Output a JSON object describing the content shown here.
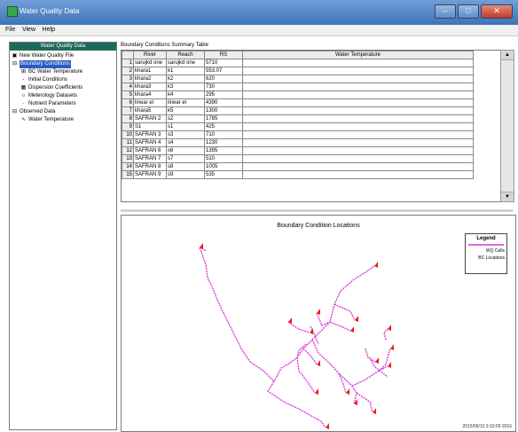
{
  "window": {
    "title": "Water Quality Data",
    "btn_min": "–",
    "btn_max": "□",
    "btn_close": "✕"
  },
  "menu": [
    "File",
    "View",
    "Help"
  ],
  "tree": {
    "header": "Water Quality Data",
    "nodes": [
      {
        "label": "New Water Quality File",
        "icon": "▣",
        "indent": 0
      },
      {
        "label": "Boundary Conditions",
        "icon": "⊟",
        "indent": 0,
        "selected": true
      },
      {
        "label": "BC Water Temperature",
        "icon": "⊞",
        "indent": 1
      },
      {
        "label": "Initial Conditions",
        "icon": "‑",
        "indent": 1
      },
      {
        "label": "Dispersion Coefficients",
        "icon": "▦",
        "indent": 1
      },
      {
        "label": "Meterology Datasets",
        "icon": "☼",
        "indent": 1
      },
      {
        "label": "Nutrient Parameters",
        "icon": "·",
        "indent": 1
      },
      {
        "label": "Observed Data",
        "icon": "⊟",
        "indent": 0
      },
      {
        "label": "Water Temperature",
        "icon": "∿",
        "indent": 1
      }
    ]
  },
  "table": {
    "caption": "Boundary Conditions Summary Table",
    "headers": [
      "River",
      "Reach",
      "RS",
      "Water Temperature"
    ],
    "rows": [
      [
        "1",
        "sarujkd one",
        "sarujkd one",
        "5710"
      ],
      [
        "2",
        "khara1",
        "k1",
        "553.07"
      ],
      [
        "3",
        "khara2",
        "k2",
        "620"
      ],
      [
        "4",
        "khara3",
        "k3",
        "730"
      ],
      [
        "5",
        "khara4",
        "k4",
        "295"
      ],
      [
        "6",
        "linear el",
        "linear el",
        "4390"
      ],
      [
        "7",
        "khara5",
        "k5",
        "1300"
      ],
      [
        "8",
        "SAFRAN 2",
        "s2",
        "1785"
      ],
      [
        "9",
        "S1",
        "s1",
        "425"
      ],
      [
        "10",
        "SAFRAN 3",
        "s3",
        "710"
      ],
      [
        "11",
        "SAFRAN 4",
        "s4",
        "1230"
      ],
      [
        "12",
        "SAFRAN 6",
        "s6",
        "1395"
      ],
      [
        "13",
        "SAFRAN 7",
        "s7",
        "510"
      ],
      [
        "14",
        "SAFRAN 8",
        "s8",
        "1005"
      ],
      [
        "15",
        "SAFRAN 9",
        "s9",
        "535"
      ]
    ]
  },
  "chart": {
    "title": "Boundary Condition Locations",
    "legend_title": "Legend",
    "legend_items": [
      "WQ Cells",
      "BC Locations"
    ],
    "stamp": "2015/09/10 3:10:09 2016"
  },
  "colors": {
    "network": "#d63bd6",
    "marker": "#e8211b",
    "selection": "#2a5bc4",
    "panel_header": "#1e6a5a"
  }
}
